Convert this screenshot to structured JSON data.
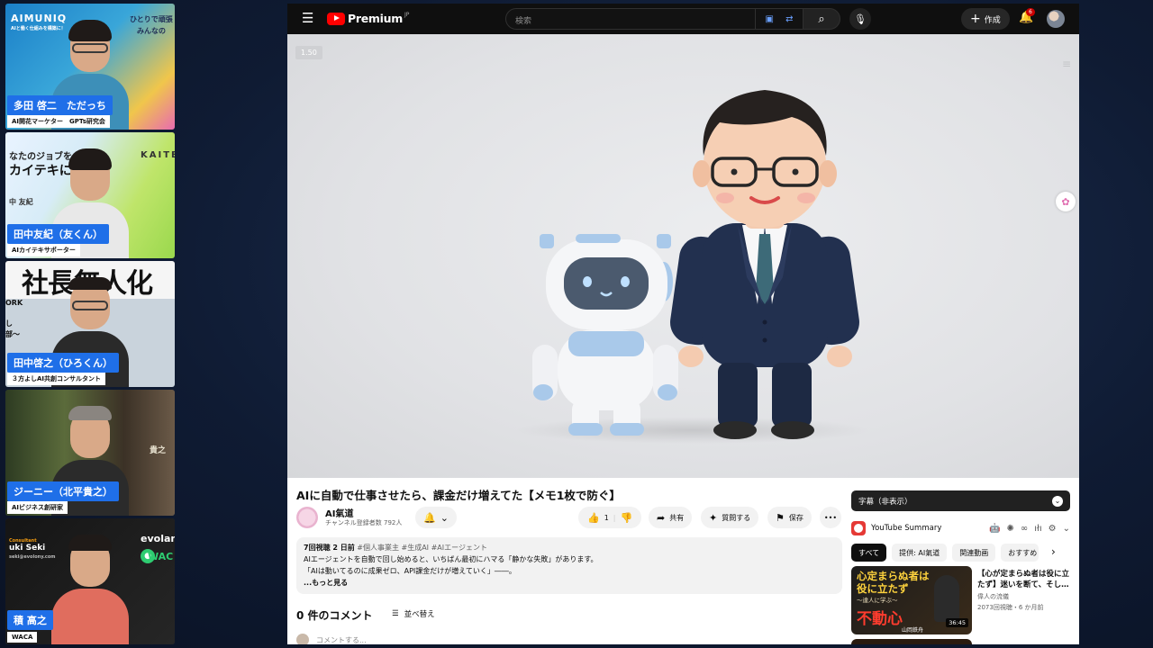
{
  "participants": [
    {
      "name": "多田 啓二　ただっち",
      "role": "AI開花マーケター　GPTs研究会",
      "bg_texts": [
        "AIMUNIQ",
        "AIと働く仕組みを構築に！",
        "ひとりで頑張",
        "みんなの"
      ]
    },
    {
      "name": "田中友紀（友くん）",
      "role": "AIカイテキサポーター",
      "bg_texts": [
        "なたのジョブを",
        "カイテキに！",
        "KAITE",
        "中 友紀"
      ]
    },
    {
      "name": "田中啓之（ひろくん）",
      "role": "３方よしAI共創コンサルタント",
      "bg_texts": [
        "社長無人化",
        "ORK",
        "し",
        "部～"
      ]
    },
    {
      "name": "ジーニー（北平貴之）",
      "role": "AIビジネス創研家",
      "bg_texts": [
        "貴之"
      ]
    },
    {
      "name": "積 高之",
      "role": "WACA",
      "bg_texts": [
        "Consultant",
        "uki Seki",
        "seki@evolony.com",
        "evolan",
        "WAC"
      ]
    }
  ],
  "youtube": {
    "brand": "Premium",
    "region": "JP",
    "search_placeholder": "検索",
    "create_label": "作成",
    "notification_count": "6",
    "speed_badge": "1.50",
    "video_title": "AIに自動で仕事させたら、課金だけ増えてた【メモ1枚で防ぐ】",
    "channel_name": "AI氣道",
    "subscribers": "チャンネル登録者数 792人",
    "like_count": "1",
    "share_label": "共有",
    "ask_label": "質問する",
    "save_label": "保存",
    "desc_meta": "7回視聴  2 日前",
    "desc_tags": "#個人事業主 #生成AI #AIエージェント",
    "desc_line1": "AIエージェントを自動で回し始めると、いちばん最初にハマる「静かな失敗」があります。",
    "desc_line2": "「AIは動いてるのに成果ゼロ、API課金だけが増えていく」――。",
    "desc_more": "...もっと見る",
    "comments_count": "0 件のコメント",
    "sort_label": "並べ替え",
    "comment_placeholder": "コメントする..."
  },
  "right_panel": {
    "caption_label": "字幕（非表示）",
    "summary_label": "YouTube Summary",
    "chips": [
      "すべて",
      "提供: AI氣道",
      "関連動画",
      "おすすめ"
    ],
    "rec_thumb_line1": "心定まらぬ者は",
    "rec_thumb_line2": "役に立たず",
    "rec_thumb_sub": "〜達人に学ぶ〜",
    "rec_thumb_big": "不動心",
    "rec_thumb_name": "山岡鉄舟",
    "rec_duration": "36:45",
    "rec_title": "【心が定まらぬ者は役に立たず】迷いを断て、そし…",
    "rec_channel": "偉人の流儀",
    "rec_stats": "2073回視聴・6 か月前"
  },
  "colors": {
    "name_label_bg": "#1f6fe8",
    "youtube_red": "#ff0000",
    "topbar": "#0f0f0f",
    "suit": "#22304f",
    "robot_accent": "#a9c9ea"
  }
}
